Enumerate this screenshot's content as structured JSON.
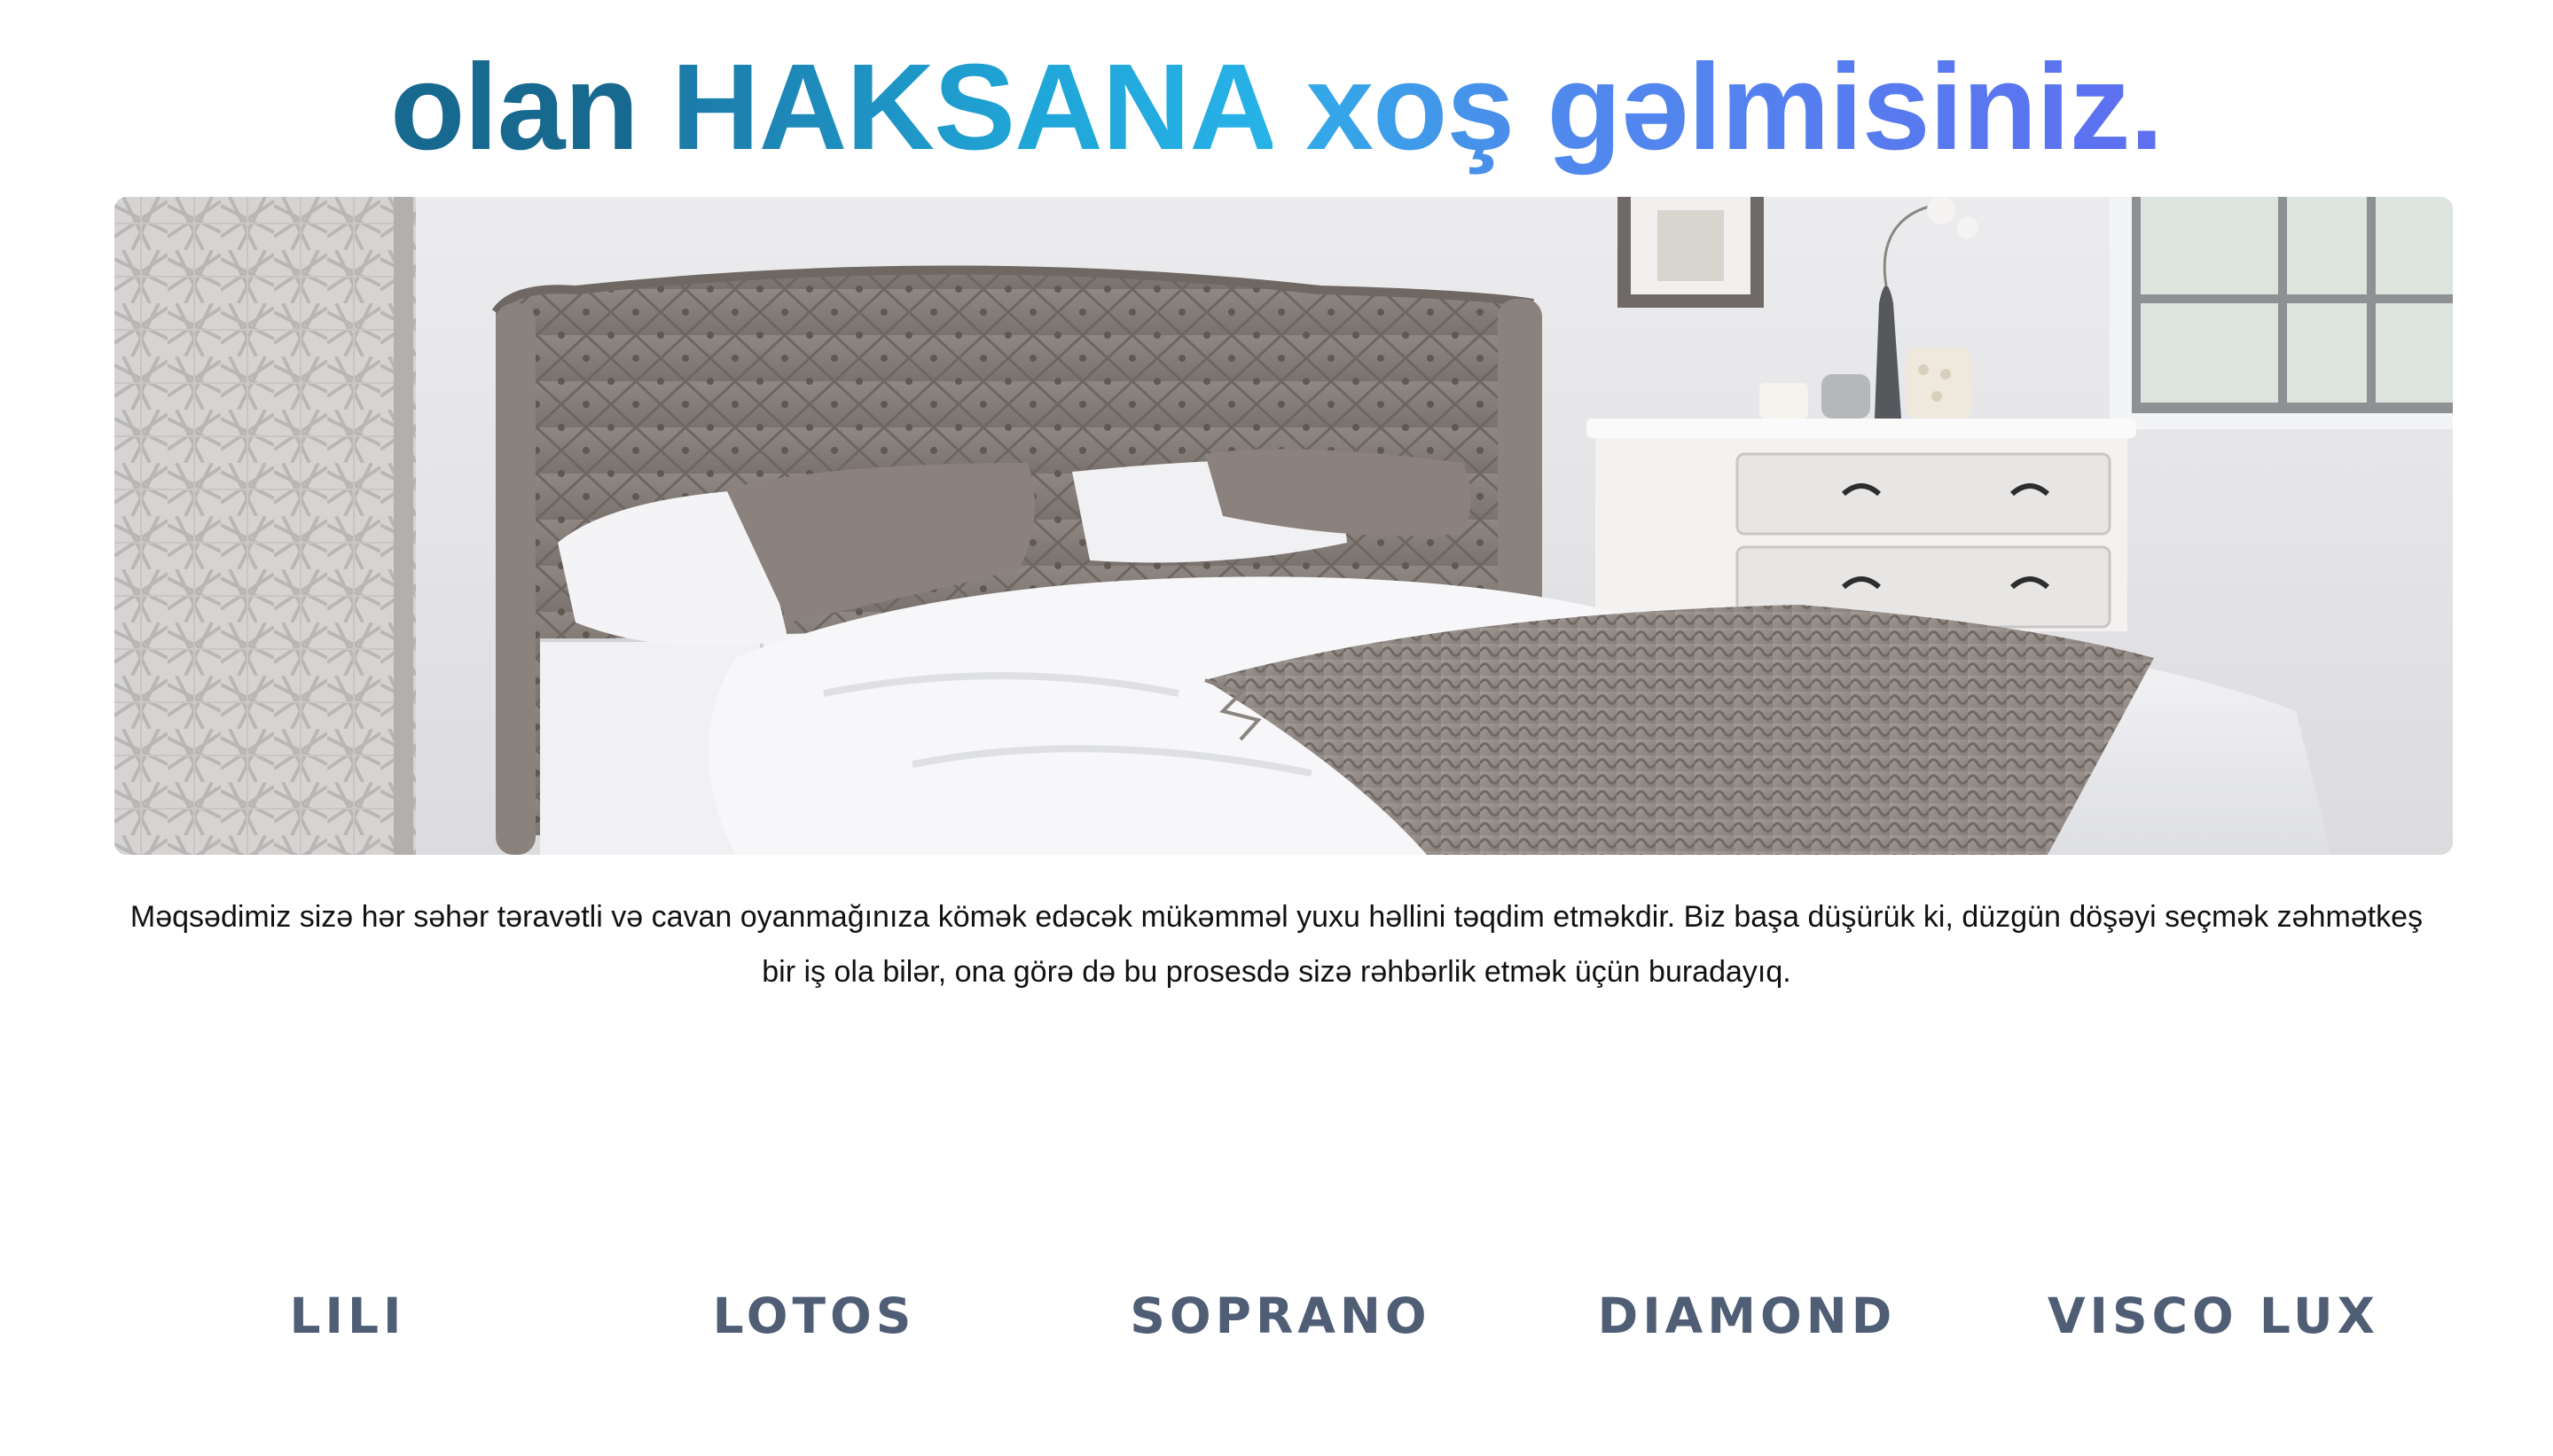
{
  "header": {
    "title_part1": "olan ",
    "title_part2": "HAKSANA",
    "title_part3": " xoş ",
    "title_part4": "gəlmisiniz."
  },
  "hero": {
    "image_alt": "Bedroom with tufted grey headboard bed and white dresser"
  },
  "intro": {
    "text": "Məqsədimiz sizə hər səhər təravətli və cavan oyanmağınıza kömək edəcək mükəmməl yuxu həllini təqdim etməkdir. Biz başa düşürük ki, düzgün döşəyi seçmək zəhmətkeş bir iş ola bilər, ona görə də bu prosesdə sizə rəhbərlik etmək üçün buradayıq."
  },
  "products": [
    {
      "label": "LILI"
    },
    {
      "label": "LOTOS"
    },
    {
      "label": "SOPRANO"
    },
    {
      "label": "DIAMOND"
    },
    {
      "label": "VISCO LUX"
    }
  ],
  "colors": {
    "title_dark": "#17698f",
    "title_mid": "#27b2e8",
    "title_end": "#5e6ff0",
    "product_text": "#4f5d75"
  }
}
